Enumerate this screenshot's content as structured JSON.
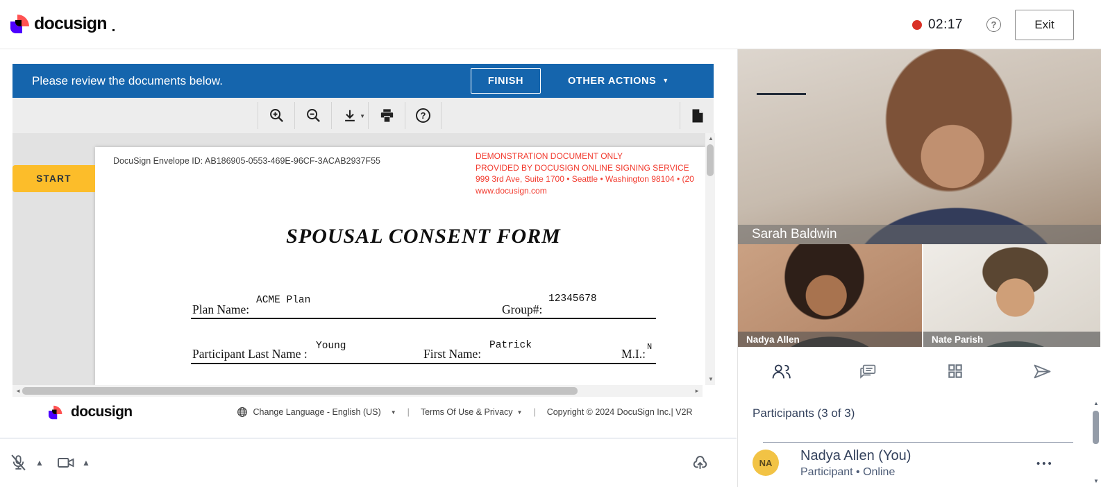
{
  "header": {
    "brand": "docusign",
    "timer": "02:17",
    "exit": "Exit"
  },
  "banner": {
    "message": "Please review the documents below.",
    "finish": "FINISH",
    "other_actions": "OTHER ACTIONS"
  },
  "start_tab": "START",
  "document": {
    "envelope_id": "DocuSign Envelope ID: AB186905-0553-469E-96CF-3ACAB2937F55",
    "demo_notice": [
      "DEMONSTRATION DOCUMENT ONLY",
      "PROVIDED BY DOCUSIGN ONLINE SIGNING SERVICE",
      "999 3rd Ave, Suite 1700  • Seattle • Washington 98104 • (20",
      "www.docusign.com"
    ],
    "title": "SPOUSAL CONSENT FORM",
    "fields": {
      "plan_label": "Plan Name:",
      "plan_value": "ACME Plan",
      "group_label": "Group#:",
      "group_value": "12345678",
      "last_label": "Participant Last Name :",
      "last_value": "Young",
      "first_label": "First Name:",
      "first_value": "Patrick",
      "mi_label": "M.I.:",
      "mi_value": "N"
    }
  },
  "doc_footer": {
    "brand": "docusign",
    "language": "Change Language - English (US)",
    "terms": "Terms Of Use & Privacy",
    "copyright": "Copyright © 2024 DocuSign Inc.| V2R",
    "separator": "|"
  },
  "video_panel": {
    "main_name": "Sarah Baldwin",
    "thumb1_name": "Nadya Allen",
    "thumb2_name": "Nate Parish",
    "participants_heading": "Participants (3 of 3)",
    "participant": {
      "initials": "NA",
      "name": "Nadya Allen (You)",
      "meta": "Participant • Online"
    }
  },
  "icons": {
    "help_glyph": "?",
    "caret_down": "▼",
    "caret_up": "▲",
    "kebab": "•••",
    "scroll_up": "▲",
    "scroll_down": "▼",
    "scroll_left": "◄",
    "scroll_right": "►",
    "names": [
      "zoom-in-icon",
      "zoom-out-icon",
      "download-icon",
      "print-icon",
      "help-icon",
      "document-icon",
      "participants-icon",
      "chat-icon",
      "layout-grid-icon",
      "send-icon",
      "mic-muted-icon",
      "camera-icon",
      "cloud-upload-icon",
      "globe-icon",
      "record-dot"
    ]
  },
  "colors": {
    "banner_blue": "#1565AD",
    "start_yellow": "#FCBD2A",
    "record_red": "#D93025",
    "demo_red": "#F23A2E",
    "avatar_yellow": "#F2C345",
    "brand_purple": "#4C00FF",
    "brand_coral": "#FF5252",
    "slate_text": "#33415C"
  }
}
